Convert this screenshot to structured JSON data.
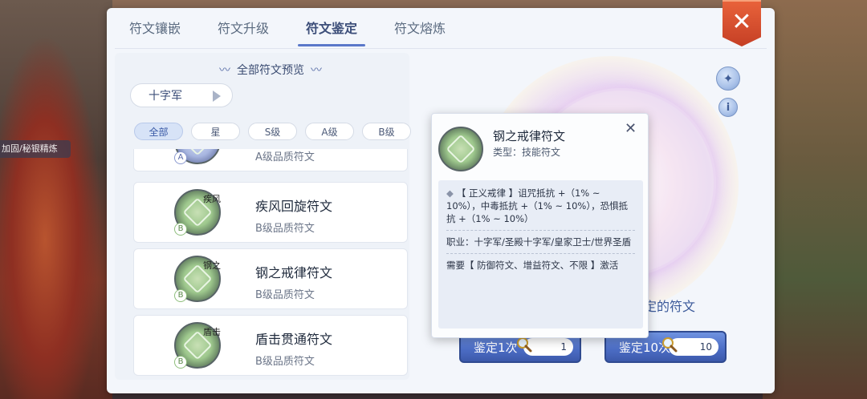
{
  "background": {
    "left_label": "加固/秘银精炼"
  },
  "tabs": [
    {
      "label": "符文镶嵌",
      "active": false
    },
    {
      "label": "符文升级",
      "active": false
    },
    {
      "label": "符文鉴定",
      "active": true
    },
    {
      "label": "符文熔炼",
      "active": false
    }
  ],
  "close_label": "✕",
  "preview": {
    "title": "全部符文预览"
  },
  "class_select": {
    "value": "十字军"
  },
  "filters": [
    {
      "label": "全部",
      "active": true
    },
    {
      "label": "星",
      "active": false
    },
    {
      "label": "S级",
      "active": false
    },
    {
      "label": "A级",
      "active": false
    },
    {
      "label": "B级",
      "active": false
    }
  ],
  "runes": [
    {
      "name": "",
      "quality": "A级品质符文",
      "grade": "A",
      "tag": ""
    },
    {
      "name": "疾风回旋符文",
      "quality": "B级品质符文",
      "grade": "B",
      "tag": "疾风"
    },
    {
      "name": "钢之戒律符文",
      "quality": "B级品质符文",
      "grade": "B",
      "tag": "钢之"
    },
    {
      "name": "盾击贯通符文",
      "quality": "B级品质符文",
      "grade": "B",
      "tag": "盾击"
    }
  ],
  "right_panel": {
    "info_text": "定的符文",
    "identify_once": {
      "label": "鉴定1次",
      "cost": "1"
    },
    "identify_ten": {
      "label": "鉴定10次",
      "cost": "10"
    },
    "wand_icon": "magic-wand-icon",
    "info_icon_label": "i"
  },
  "tooltip": {
    "name": "钢之戒律符文",
    "type": "类型：技能符文",
    "close": "✕",
    "effect": "【 正义戒律 】诅咒抵抗 +（1% ~ 10%），中毒抵抗 +（1% ~ 10%），恐惧抵抗 +（1% ~ 10%）",
    "bullet": "◆",
    "jobs": "职业：十字军/圣殿十字军/皇家卫士/世界圣盾",
    "require": "需要【 防御符文、增益符文、不限 】激活"
  }
}
